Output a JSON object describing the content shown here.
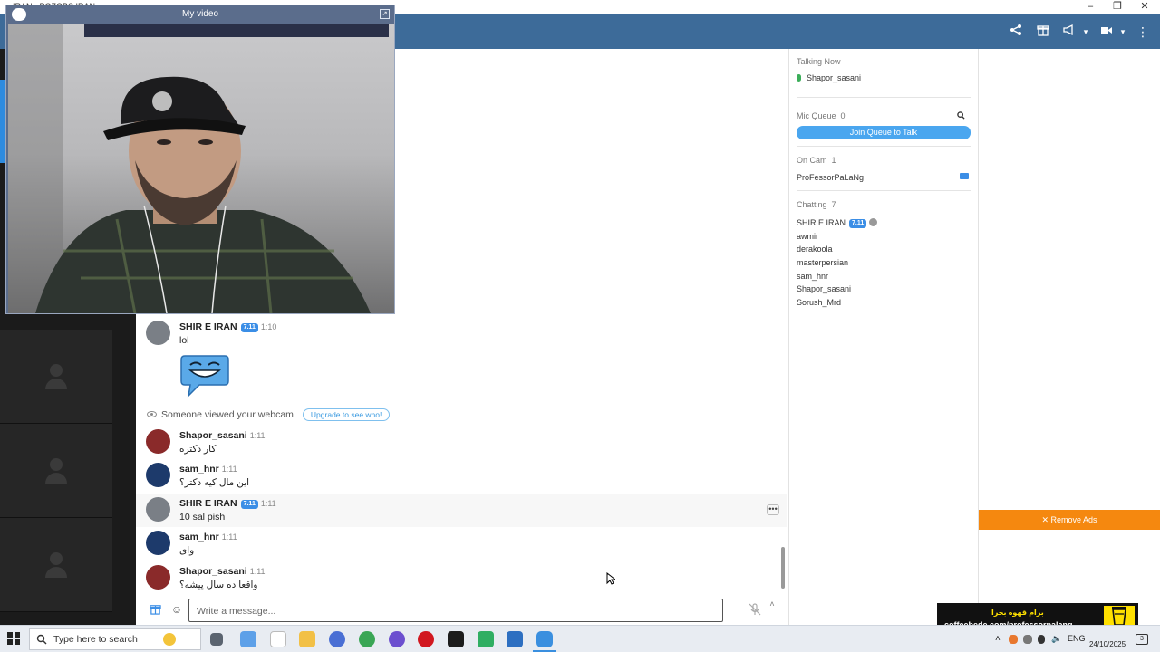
{
  "window": {
    "title": "IRAN - POZOBS IRAN",
    "minimize": "–",
    "restore": "❐",
    "close": "✕"
  },
  "video_window": {
    "title": "My video",
    "popout_icon": "popout-icon"
  },
  "header_icons": [
    "share-icon",
    "gift-icon",
    "megaphone-icon",
    "camera-icon",
    "more-vert-icon"
  ],
  "chat": {
    "messages": [
      {
        "user": "SHIR E IRAN",
        "badge": "7.11",
        "time": "1:10",
        "text": "lol"
      },
      {
        "user": "Shapor_sasani",
        "badge": "",
        "time": "1:11",
        "text": "کار دکتره"
      },
      {
        "user": "sam_hnr",
        "badge": "",
        "time": "1:11",
        "text": "این مال کیه دکتر؟"
      },
      {
        "user": "SHIR E IRAN",
        "badge": "7.11",
        "time": "1:11",
        "text": "10 sal pish"
      },
      {
        "user": "sam_hnr",
        "badge": "",
        "time": "1:11",
        "text": "وای"
      },
      {
        "user": "Shapor_sasani",
        "badge": "",
        "time": "1:11",
        "text": "واقعا ده سال پیشه؟"
      }
    ],
    "system_notice": "Someone viewed your webcam",
    "upgrade_label": "Upgrade to see who!",
    "more_label": "•••",
    "input_placeholder": "Write a message..."
  },
  "right_panel": {
    "talking_now": {
      "label": "Talking Now",
      "user": "Shapor_sasani"
    },
    "mic_queue": {
      "label": "Mic Queue",
      "count": "0",
      "join_label": "Join Queue to Talk"
    },
    "on_cam": {
      "label": "On Cam",
      "count": "1",
      "user": "ProFessorPaLaNg"
    },
    "chatting": {
      "label": "Chatting",
      "count": "7",
      "first_badge": "7.11",
      "users": [
        "SHIR E IRAN",
        "awmir",
        "derakoola",
        "masterpersian",
        "sam_hnr",
        "Shapor_sasani",
        "Sorush_Mrd"
      ]
    }
  },
  "ads": {
    "remove_label": "✕ Remove Ads",
    "coffee_line1": "برام قهوه بخرا",
    "coffee_line2": "coffeebede.com/professorpalang"
  },
  "taskbar": {
    "search_placeholder": "Type here to search",
    "lang": "ENG",
    "date": "24/10/2025",
    "notif_count": "3"
  },
  "colors": {
    "header_blue": "#3d6b99",
    "join_button": "#4aa6ef",
    "remove_ads": "#f5880f",
    "badge_blue": "#3b8ee6"
  }
}
